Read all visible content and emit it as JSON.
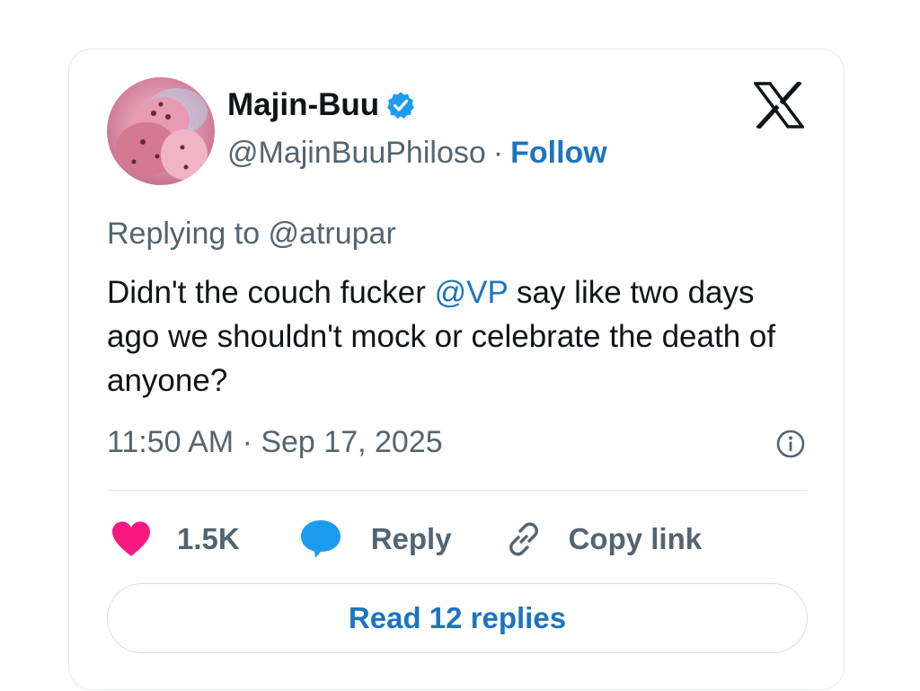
{
  "author": {
    "display_name": "Majin-Buu",
    "handle": "@MajinBuuPhiloso",
    "separator": "·",
    "follow_label": "Follow",
    "verified": true,
    "avatar_icon": "avatar-pink-figure"
  },
  "platform_logo": "x-logo",
  "tweet": {
    "replying_to": "Replying to @atrupar",
    "text_before_mention": "Didn't the couch fucker ",
    "mention": "@VP",
    "text_after_mention": " say like two days ago we shouldn't mock or celebrate the death of anyone?",
    "timestamp": "11:50 AM · Sep 17, 2025"
  },
  "actions": {
    "like_count": "1.5K",
    "reply_label": "Reply",
    "copy_label": "Copy link"
  },
  "read_replies_label": "Read 12 replies",
  "colors": {
    "accent": "#1d74bf",
    "verified": "#1d9bf0",
    "like": "#f91880",
    "secondary_text": "#536471",
    "primary_text": "#0f1419"
  }
}
